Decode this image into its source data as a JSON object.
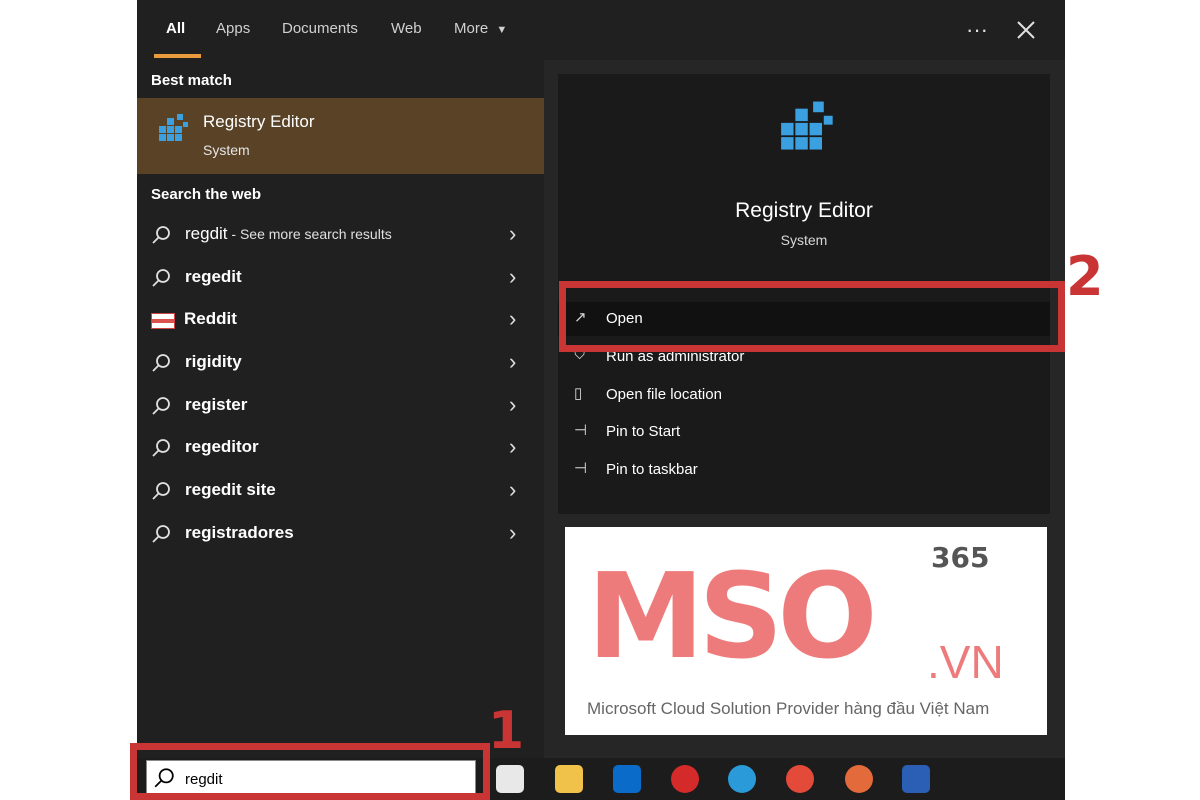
{
  "tabs": {
    "items": [
      {
        "label": "All",
        "active": true
      },
      {
        "label": "Apps"
      },
      {
        "label": "Documents"
      },
      {
        "label": "Web"
      },
      {
        "label": "More",
        "has_dropdown": true
      }
    ],
    "more_icon": "ellipsis-icon",
    "close_icon": "close-icon"
  },
  "best_match": {
    "heading": "Best match",
    "title": "Registry Editor",
    "subtitle": "System",
    "icon": "registry-editor-icon"
  },
  "web": {
    "heading": "Search the web",
    "items": [
      {
        "query": "regdit",
        "suffix": " - See more search results",
        "icon": "search-icon"
      },
      {
        "query": "regedit",
        "icon": "search-icon"
      },
      {
        "query": "Reddit",
        "icon": "reddit-logo-icon"
      },
      {
        "query": "rigidity",
        "icon": "search-icon"
      },
      {
        "query": "register",
        "icon": "search-icon"
      },
      {
        "query": "regeditor",
        "icon": "search-icon"
      },
      {
        "query": "regedit site",
        "icon": "search-icon"
      },
      {
        "query": "registradores",
        "icon": "search-icon"
      }
    ]
  },
  "detail": {
    "title": "Registry Editor",
    "subtitle": "System",
    "actions": [
      {
        "label": "Open",
        "icon": "open-icon"
      },
      {
        "label": "Run as administrator",
        "icon": "shield-icon"
      },
      {
        "label": "Open file location",
        "icon": "file-location-icon"
      },
      {
        "label": "Pin to Start",
        "icon": "pin-icon"
      },
      {
        "label": "Pin to taskbar",
        "icon": "pin-icon"
      }
    ]
  },
  "watermark": {
    "brand": "MSO",
    "edition": "365",
    "domain": ".VN",
    "tagline": "Microsoft Cloud Solution Provider hàng đầu Việt Nam"
  },
  "annotations": {
    "step1": "1",
    "step2": "2"
  },
  "taskbar": {
    "search_value": "regdit",
    "apps": [
      "task-view-icon",
      "file-explorer-icon",
      "outlook-icon",
      "opera-icon",
      "edge-icon",
      "chrome-icon",
      "chrome-profile-icon",
      "word-icon"
    ]
  },
  "colors": {
    "panel_bg": "#202020",
    "best_match_bg": "#5a4227",
    "tab_underline": "#e89a3c",
    "annotation_red": "#c93434",
    "watermark_pink": "#ee7b7b"
  }
}
